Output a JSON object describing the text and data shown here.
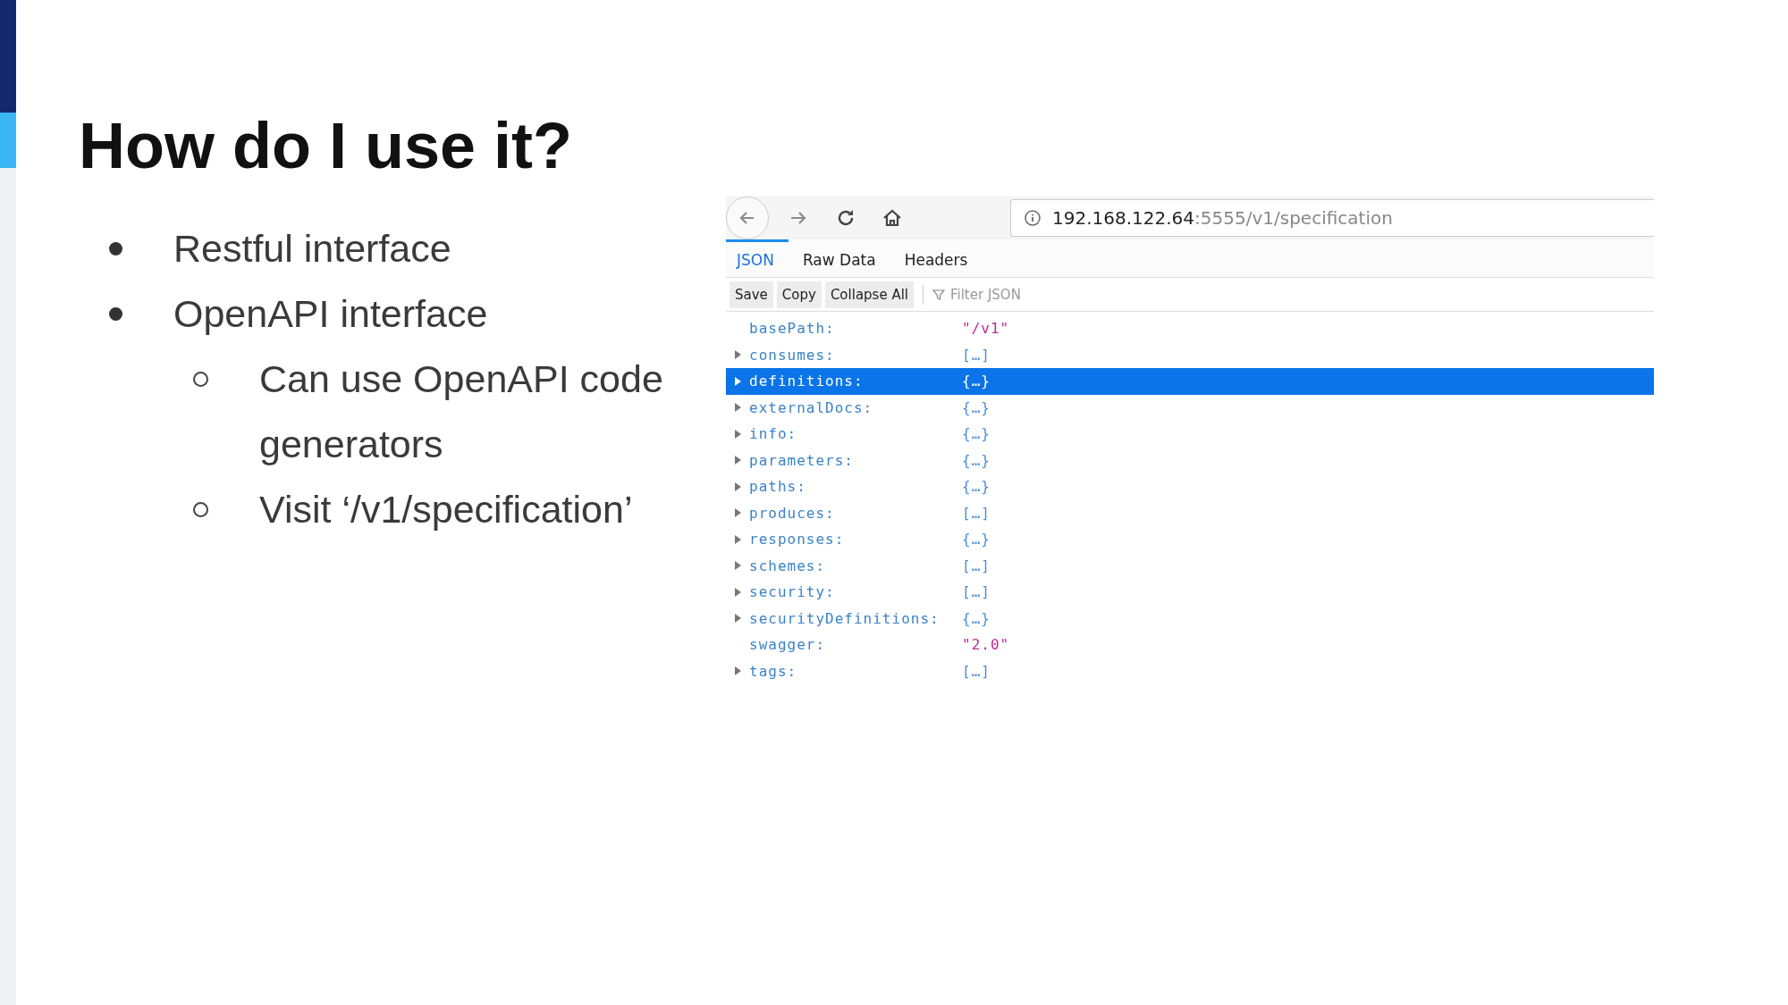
{
  "title": "How do I use it?",
  "bullets": [
    {
      "text": "Restful interface"
    },
    {
      "text": "OpenAPI interface",
      "children": [
        {
          "text": "Can use OpenAPI code generators"
        },
        {
          "text": "Visit ‘/v1/specification’"
        }
      ]
    }
  ],
  "browser": {
    "url_host": "192.168.122.64",
    "url_rest": ":5555/v1/specification",
    "tabs": [
      {
        "label": "JSON",
        "selected": true
      },
      {
        "label": "Raw Data",
        "selected": false
      },
      {
        "label": "Headers",
        "selected": false
      }
    ],
    "toolbar_buttons": [
      "Save",
      "Copy",
      "Collapse All"
    ],
    "filter": {
      "placeholder": "Filter JSON"
    },
    "rows": [
      {
        "key": "basePath:",
        "value": "\"/v1\"",
        "kind": "string",
        "selected": false
      },
      {
        "key": "consumes:",
        "value": "[…]",
        "kind": "collapsed",
        "selected": false
      },
      {
        "key": "definitions:",
        "value": "{…}",
        "kind": "collapsed",
        "selected": true
      },
      {
        "key": "externalDocs:",
        "value": "{…}",
        "kind": "collapsed",
        "selected": false
      },
      {
        "key": "info:",
        "value": "{…}",
        "kind": "collapsed",
        "selected": false
      },
      {
        "key": "parameters:",
        "value": "{…}",
        "kind": "collapsed",
        "selected": false
      },
      {
        "key": "paths:",
        "value": "{…}",
        "kind": "collapsed",
        "selected": false
      },
      {
        "key": "produces:",
        "value": "[…]",
        "kind": "collapsed",
        "selected": false
      },
      {
        "key": "responses:",
        "value": "{…}",
        "kind": "collapsed",
        "selected": false
      },
      {
        "key": "schemes:",
        "value": "[…]",
        "kind": "collapsed",
        "selected": false
      },
      {
        "key": "security:",
        "value": "[…]",
        "kind": "collapsed",
        "selected": false
      },
      {
        "key": "securityDefinitions:",
        "value": "{…}",
        "kind": "collapsed",
        "selected": false
      },
      {
        "key": "swagger:",
        "value": "\"2.0\"",
        "kind": "string",
        "selected": false
      },
      {
        "key": "tags:",
        "value": "[…]",
        "kind": "collapsed",
        "selected": false
      }
    ]
  }
}
